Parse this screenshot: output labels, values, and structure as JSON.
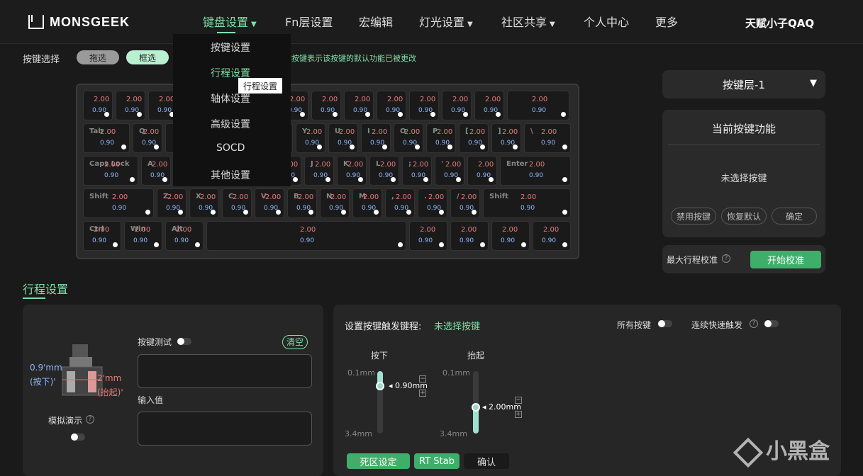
{
  "brand": "MONSGEEK",
  "nav": [
    {
      "label": "键盘设置",
      "active": true,
      "caret": true
    },
    {
      "label": "Fn层设置",
      "active": false,
      "caret": false
    },
    {
      "label": "宏编辑",
      "active": false,
      "caret": false
    },
    {
      "label": "灯光设置",
      "active": false,
      "caret": true
    },
    {
      "label": "社区共享",
      "active": false,
      "caret": true
    },
    {
      "label": "个人中心",
      "active": false,
      "caret": false
    },
    {
      "label": "更多",
      "active": false,
      "caret": false
    }
  ],
  "user": "天赋小子QAQ",
  "key_select": {
    "label": "按键选择",
    "drag": "拖选",
    "box": "框选",
    "hint": "的按键表示该按键的默认功能已被更改"
  },
  "dropdown": {
    "items": [
      "按键设置",
      "行程设置",
      "轴体设置",
      "高级设置",
      "SOCD",
      "其他设置"
    ],
    "active_index": 1,
    "tooltip": "行程设置"
  },
  "keyboard": {
    "down_value": "0.90",
    "up_value": "2.00",
    "labels": [
      "Tab",
      "Q",
      "Y",
      "U",
      "I",
      "O",
      "P",
      "[",
      "]",
      "\\",
      "Caps Lock",
      "A",
      "H",
      "J",
      "K",
      "L",
      ";",
      "'",
      "Enter",
      "Shift",
      "Z",
      "X",
      "C",
      "V",
      "B",
      "N",
      "M",
      ",",
      ".",
      "/",
      "Shift",
      "Ctrl",
      "Win",
      "Alt"
    ]
  },
  "right": {
    "layer": "按键层-1",
    "current_title": "当前按键功能",
    "no_key": "未选择按键",
    "buttons": [
      "禁用按键",
      "恢复默认",
      "确定"
    ],
    "calib_label": "最大行程校准",
    "calib_btn": "开始校准"
  },
  "section_title": "行程设置",
  "left_card": {
    "down_label": "0.9'mm",
    "down_sub": "(按下)'",
    "up_label": "2'mm",
    "up_sub": "(抬起)'",
    "demo_label": "模拟演示",
    "test_label": "按键测试",
    "clear": "清空",
    "input_label": "输入值"
  },
  "trigger": {
    "title": "设置按键触发键程:",
    "status": "未选择按键",
    "all_keys": "所有按键",
    "rapid": "连续快速触发",
    "press": "按下",
    "release": "抬起",
    "min": "0.1mm",
    "max": "3.4mm",
    "press_value": "0.90mm",
    "release_value": "2.00mm",
    "press_level": 0.9,
    "release_level": 2.0,
    "buttons": [
      "死区设定",
      "RT Stab",
      "确认"
    ]
  },
  "watermark": "小黑盒"
}
